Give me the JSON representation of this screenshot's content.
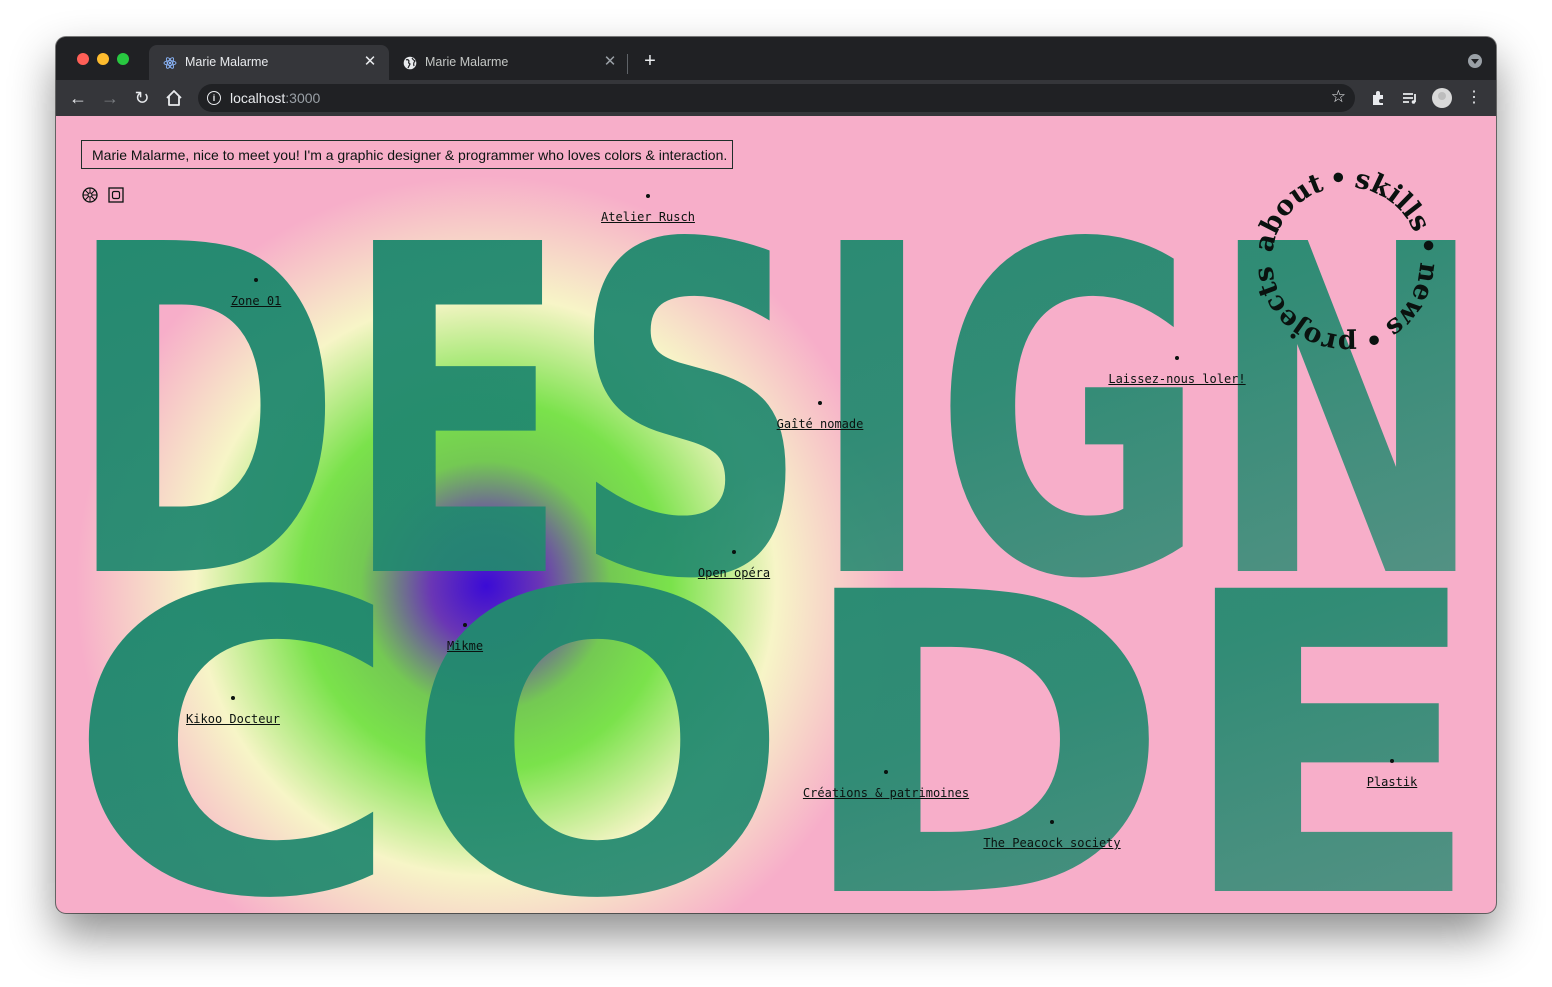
{
  "browser": {
    "tabs": [
      {
        "title": "Marie Malarme",
        "favicon": "react-icon",
        "active": true
      },
      {
        "title": "Marie Malarme",
        "favicon": "globe-icon",
        "active": false
      }
    ],
    "new_tab_label": "+",
    "url_host": "localhost",
    "url_port": ":3000"
  },
  "page": {
    "bio": "Marie Malarme, nice to meet you! I'm a graphic designer & programmer who loves colors & interaction.",
    "big_words": [
      "DESIGN",
      "CODE"
    ],
    "colors": {
      "background": "#f7aec9",
      "letter_green": "#22896f",
      "glow_blue": "#3b0bd6",
      "glow_green": "#7ae24b",
      "glow_cream": "#f7f5c7"
    },
    "controls": [
      {
        "name": "settings-wheel-icon"
      },
      {
        "name": "square-frame-icon"
      }
    ],
    "projects": [
      {
        "label": "Atelier Rusch"
      },
      {
        "label": "Zone 01"
      },
      {
        "label": "Laissez-nous loler!"
      },
      {
        "label": "Gaîté nomade"
      },
      {
        "label": "Open opéra"
      },
      {
        "label": "Mikme"
      },
      {
        "label": "Kikoo Docteur"
      },
      {
        "label": "Plastik"
      },
      {
        "label": "Créations & patrimoines"
      },
      {
        "label": "The Peacock society"
      }
    ],
    "circular_menu": [
      {
        "label": "about"
      },
      {
        "label": "skills"
      },
      {
        "label": "news"
      },
      {
        "label": "projects"
      }
    ]
  }
}
